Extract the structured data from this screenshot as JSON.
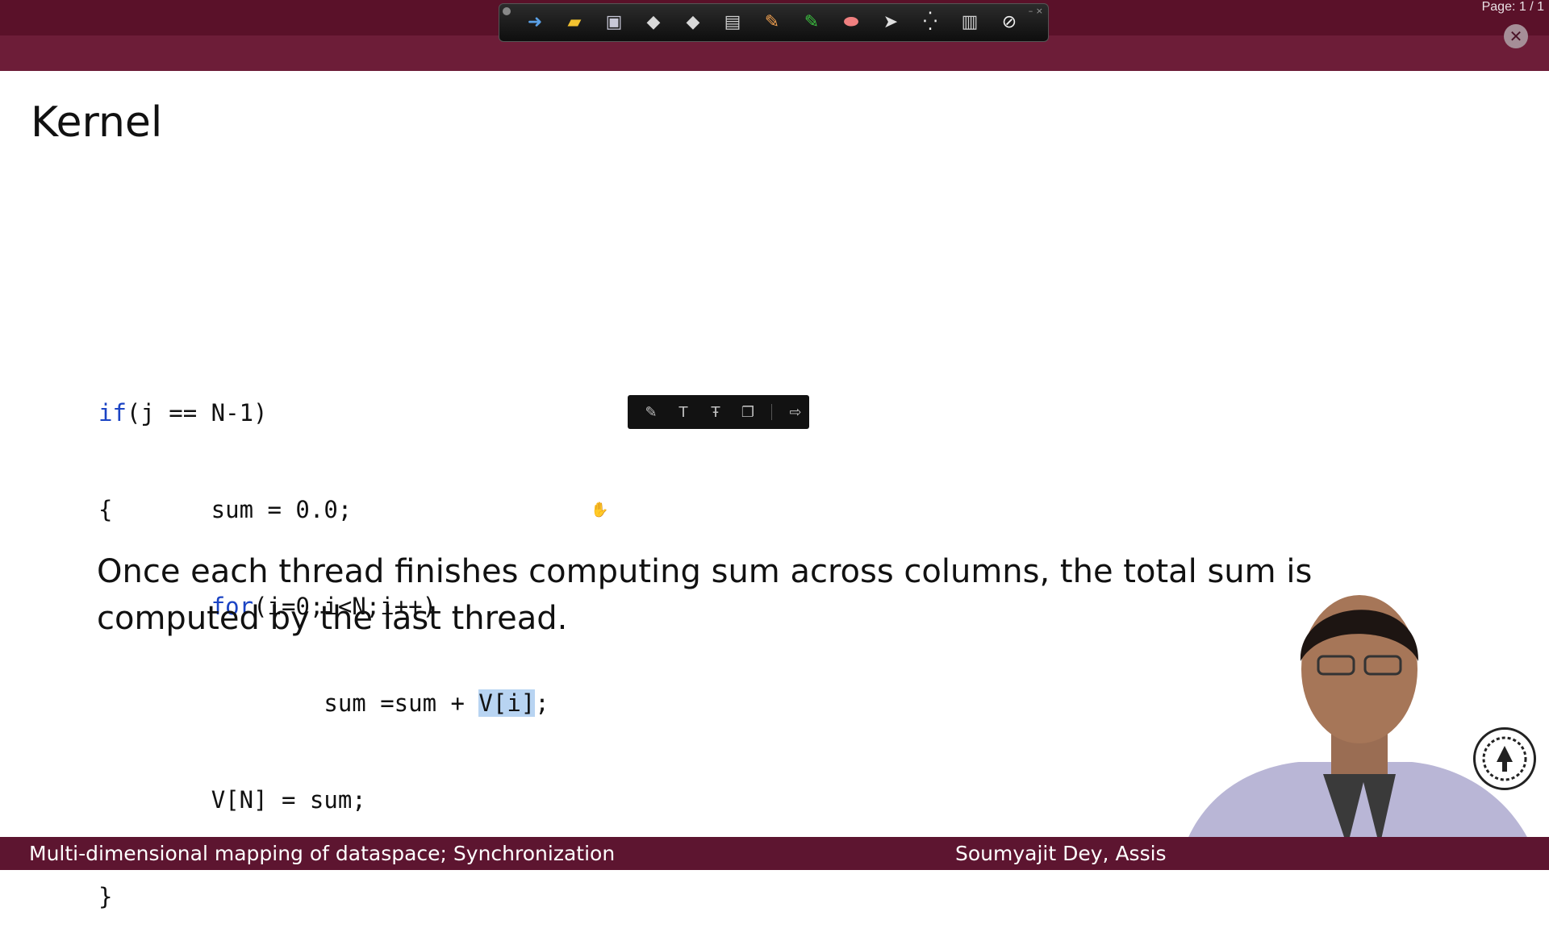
{
  "window": {
    "page_indicator": "Page: 1 / 1",
    "close_glyph": "✕"
  },
  "toolbar": {
    "icons": [
      {
        "name": "star-open-icon",
        "glyph": "➜",
        "color": "#5aa0e6"
      },
      {
        "name": "folder-icon",
        "glyph": "▰",
        "color": "#f2c230"
      },
      {
        "name": "save-disk-icon",
        "glyph": "▣",
        "color": "#c8c8d8"
      },
      {
        "name": "arrow-right-page-icon",
        "glyph": "◆",
        "color": "#d8d8d8"
      },
      {
        "name": "arrow-left-page-icon",
        "glyph": "◆",
        "color": "#d8d8d8"
      },
      {
        "name": "printer-icon",
        "glyph": "▤",
        "color": "#cfcfcf"
      },
      {
        "name": "pencil-icon",
        "glyph": "✎",
        "color": "#f0a050"
      },
      {
        "name": "highlighter-icon",
        "glyph": "✎",
        "color": "#3cc040"
      },
      {
        "name": "eraser-icon",
        "glyph": "⬬",
        "color": "#f08080"
      },
      {
        "name": "pointer-arrow-icon",
        "glyph": "➤",
        "color": "#e0e0e0"
      },
      {
        "name": "laser-dots-icon",
        "glyph": "⁛",
        "color": "#f0f0f0"
      },
      {
        "name": "screen-icon",
        "glyph": "▥",
        "color": "#d0d0d0"
      },
      {
        "name": "disable-icon",
        "glyph": "⊘",
        "color": "#f0f0f0"
      }
    ]
  },
  "slide": {
    "title": "Kernel",
    "code_lines": [
      {
        "indent": "",
        "kw": "if",
        "rest": "(j == N-1)"
      },
      {
        "indent": "",
        "kw": "",
        "rest": "{       sum = 0.0;"
      },
      {
        "indent": "        ",
        "kw": "for",
        "rest": "(i=0;i<N;i++)"
      },
      {
        "indent": "                ",
        "kw": "",
        "rest": "sum =sum + ",
        "highlight": "V[i]",
        "after": ";"
      },
      {
        "indent": "        ",
        "kw": "",
        "rest": "V[N] = sum;"
      },
      {
        "indent": "",
        "kw": "",
        "rest": "}"
      }
    ],
    "body_text": "Once each thread finishes computing sum across columns, the total sum is computed by the last thread."
  },
  "floating_toolbar": {
    "icons": [
      {
        "name": "pen-annotate-icon",
        "glyph": "✎"
      },
      {
        "name": "text-icon",
        "glyph": "T"
      },
      {
        "name": "strikethrough-icon",
        "glyph": "Ŧ"
      },
      {
        "name": "copy-icon",
        "glyph": "❐"
      },
      {
        "name": "share-icon",
        "glyph": "⇨"
      }
    ]
  },
  "footer": {
    "left": "Multi-dimensional mapping of dataspace; Synchronization",
    "right": "Soumyajit Dey, Assis"
  },
  "colors": {
    "header_bg": "#6d1d38",
    "footer_bg": "#5d1530",
    "keyword": "#1b44c4",
    "selection": "#b8d4f2"
  }
}
